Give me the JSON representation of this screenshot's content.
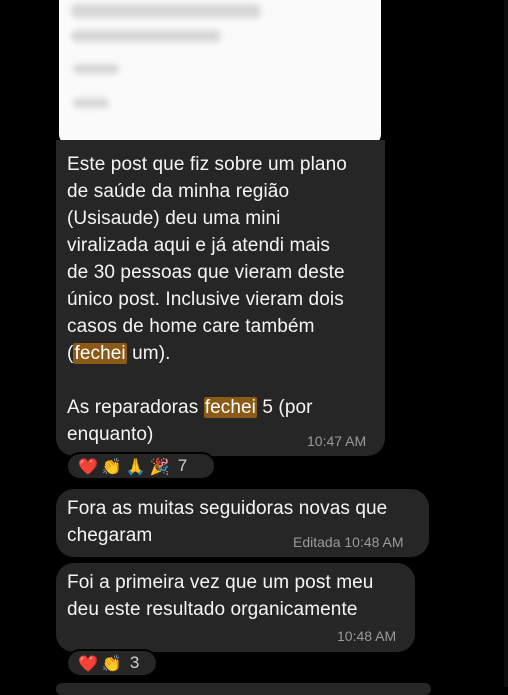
{
  "messages": [
    {
      "text_parts": [
        "Este post que fiz sobre um plano\nde saúde da minha região\n(Usisaude) deu uma mini\nviralizada aqui e já atendi mais\nde 30 pessoas que vieram deste\núnico post. Inclusive vieram dois\ncasos de home care também\n(",
        "fechei",
        " um).\n\nAs reparadoras ",
        "fechei",
        " 5 (por\nenquanto)"
      ],
      "time": "10:47 AM",
      "reactions": {
        "emojis": [
          "❤️",
          "👏",
          "🙏",
          "🎉"
        ],
        "count": "7"
      }
    },
    {
      "text": "Fora as muitas seguidoras novas que\nchegaram",
      "time": "Editada 10:48 AM"
    },
    {
      "text": "Foi a primeira vez que um post meu\ndeu este resultado organicamente",
      "time": "10:48 AM",
      "reactions": {
        "emojis": [
          "❤️",
          "👏"
        ],
        "count": "3"
      }
    }
  ],
  "colors": {
    "background": "#000000",
    "bubble": "#262626",
    "highlight": "#8a5a16",
    "time_text": "#9a9a9a"
  }
}
